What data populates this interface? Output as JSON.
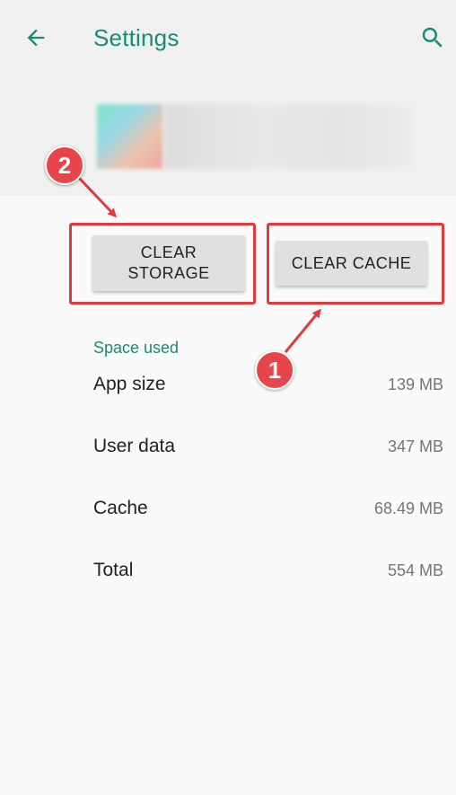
{
  "toolbar": {
    "title": "Settings",
    "back_icon": "arrow-back-icon",
    "search_icon": "search-icon"
  },
  "actions": {
    "clear_storage": "CLEAR STORAGE",
    "clear_cache": "CLEAR CACHE"
  },
  "annotations": {
    "step_cache": "1",
    "step_storage": "2"
  },
  "space_used": {
    "title": "Space used",
    "rows": [
      {
        "label": "App size",
        "value": "139 MB"
      },
      {
        "label": "User data",
        "value": "347 MB"
      },
      {
        "label": "Cache",
        "value": "68.49 MB"
      },
      {
        "label": "Total",
        "value": "554 MB"
      }
    ]
  },
  "colors": {
    "accent": "#1a8a7a",
    "annotation": "#e03a3e"
  }
}
